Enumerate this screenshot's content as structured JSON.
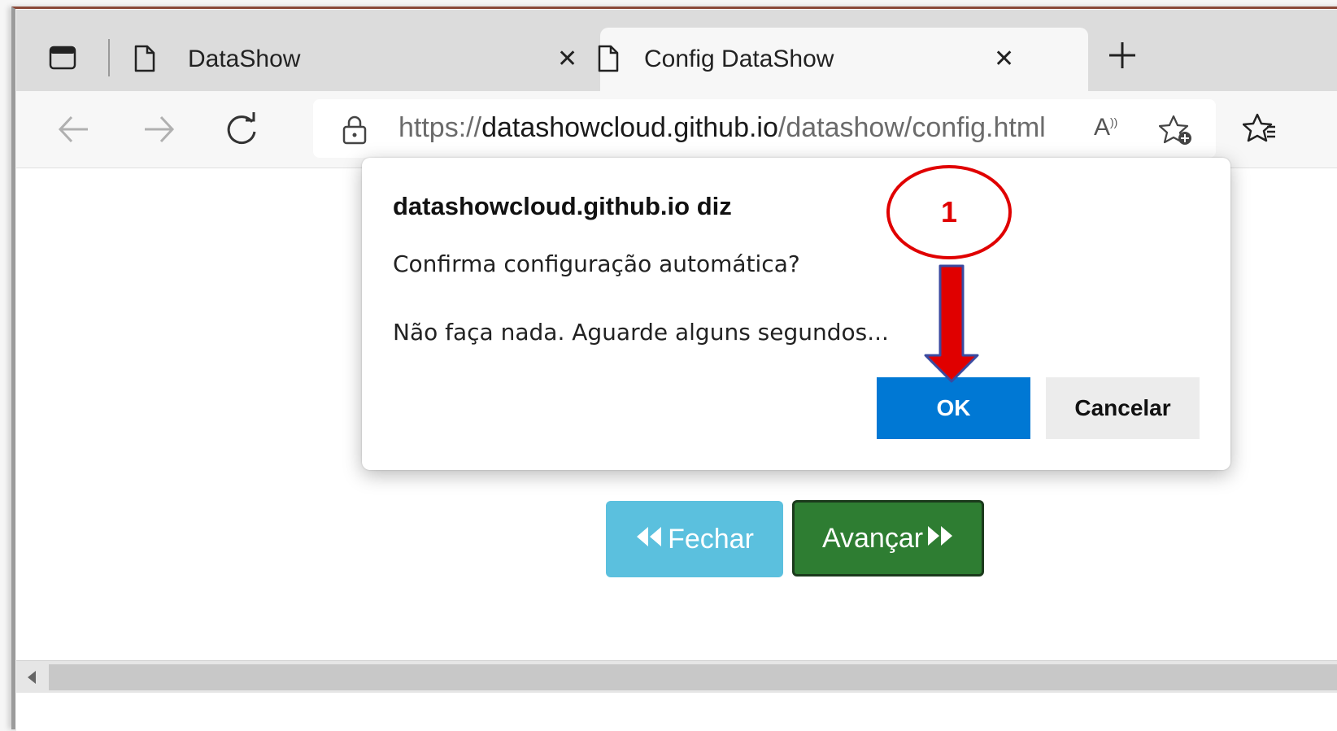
{
  "browser": {
    "tabs": [
      {
        "label": "DataShow",
        "active": false
      },
      {
        "label": "Config DataShow",
        "active": true
      }
    ],
    "new_tab_icon": "plus-icon",
    "address_bar": {
      "url_prefix": "https://",
      "url_host": "datashowcloud.github.io",
      "url_path": "/datashow/config.html"
    }
  },
  "page": {
    "buttons": {
      "fechar_label": "Fechar",
      "avancar_label": "Avançar"
    },
    "colors": {
      "fechar": "#5bc0de",
      "avancar": "#2e7d32"
    }
  },
  "dialog": {
    "title": "datashowcloud.github.io diz",
    "message_line1": "Confirma configuração automática?",
    "message_line2": "Não faça nada. Aguarde alguns segundos...",
    "ok_label": "OK",
    "cancel_label": "Cancelar",
    "ok_color": "#0078d4"
  },
  "annotation": {
    "step_number": "1",
    "color": "#e00000"
  }
}
